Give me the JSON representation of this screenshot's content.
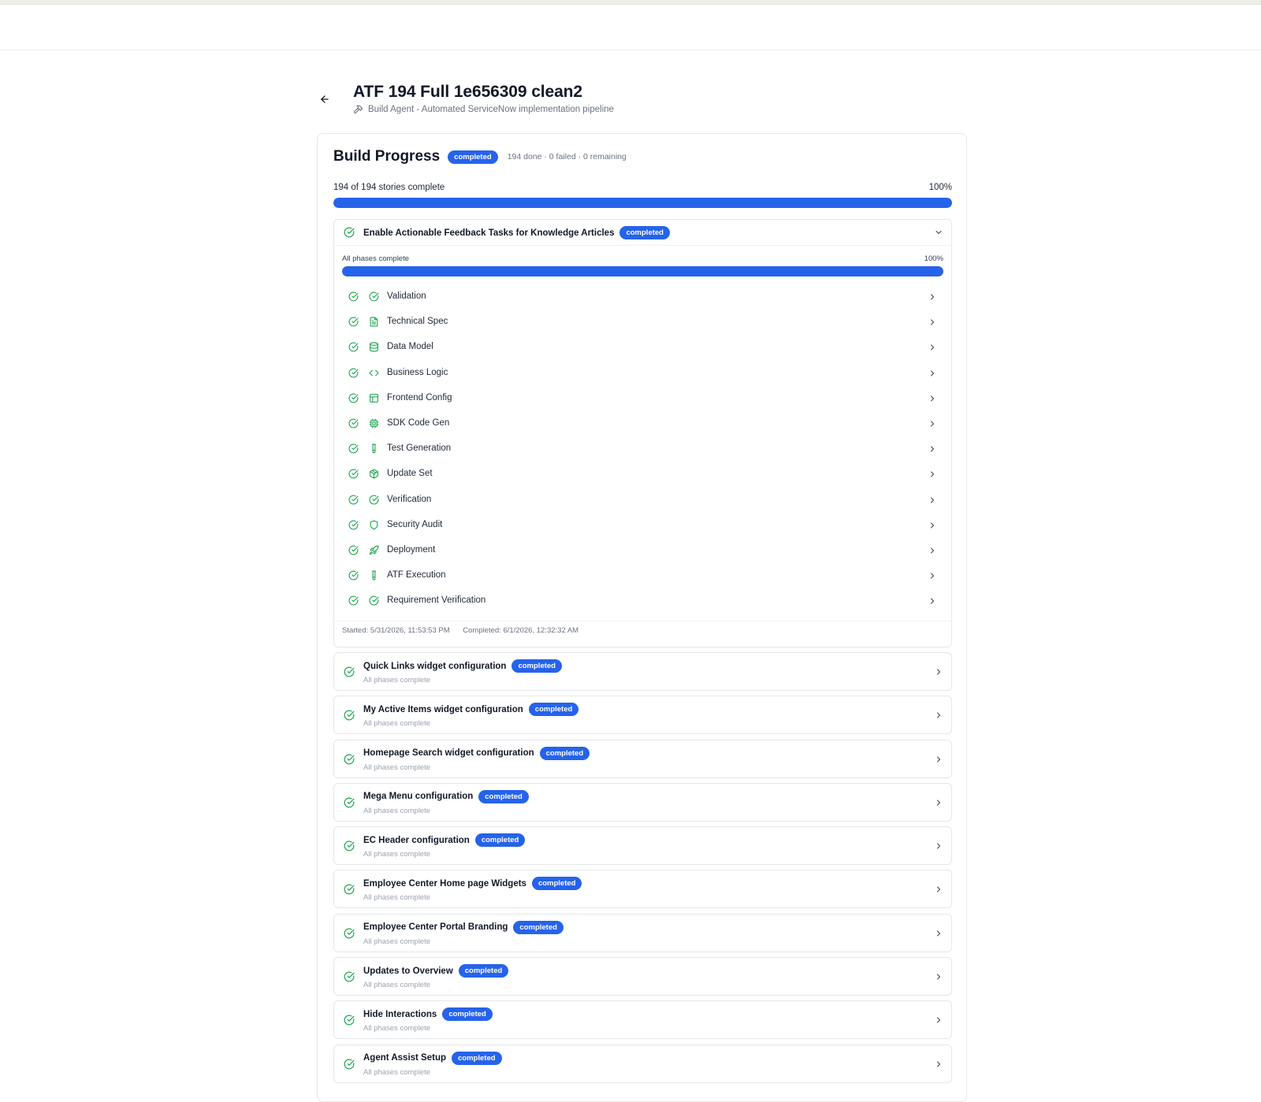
{
  "header": {
    "title": "ATF 194 Full 1e656309 clean2",
    "subtitle": "Build Agent - Automated ServiceNow implementation pipeline",
    "back_icon": "arrow-left-icon",
    "subtitle_icon": "hammer-icon"
  },
  "build_progress": {
    "title": "Build Progress",
    "status": "completed",
    "stats": "194 done · 0 failed · 0 remaining",
    "summary": "194 of 194 stories complete",
    "percent_label": "100%",
    "progress_fraction": 1.0
  },
  "expanded_story": {
    "title": "Enable Actionable Feedback Tasks for Knowledge Articles",
    "status": "completed",
    "phase_summary": "All phases complete",
    "phase_percent_label": "100%",
    "phase_progress_fraction": 1.0,
    "phases": [
      {
        "label": "Validation",
        "icon": "check-circle-icon"
      },
      {
        "label": "Technical Spec",
        "icon": "file-text-icon"
      },
      {
        "label": "Data Model",
        "icon": "database-icon"
      },
      {
        "label": "Business Logic",
        "icon": "code-icon"
      },
      {
        "label": "Frontend Config",
        "icon": "layout-icon"
      },
      {
        "label": "SDK Code Gen",
        "icon": "cpu-icon"
      },
      {
        "label": "Test Generation",
        "icon": "test-tube-icon"
      },
      {
        "label": "Update Set",
        "icon": "package-icon"
      },
      {
        "label": "Verification",
        "icon": "check-circle-icon"
      },
      {
        "label": "Security Audit",
        "icon": "shield-icon"
      },
      {
        "label": "Deployment",
        "icon": "rocket-icon"
      },
      {
        "label": "ATF Execution",
        "icon": "test-tube-icon"
      },
      {
        "label": "Requirement Verification",
        "icon": "check-circle-icon"
      }
    ],
    "started": "Started: 5/31/2026, 11:53:53 PM",
    "completed": "Completed: 6/1/2026, 12:32:32 AM"
  },
  "stories": [
    {
      "title": "Quick Links widget configuration",
      "status": "completed",
      "subtitle": "All phases complete"
    },
    {
      "title": "My Active Items widget configuration",
      "status": "completed",
      "subtitle": "All phases complete"
    },
    {
      "title": "Homepage Search widget configuration",
      "status": "completed",
      "subtitle": "All phases complete"
    },
    {
      "title": "Mega Menu configuration",
      "status": "completed",
      "subtitle": "All phases complete"
    },
    {
      "title": "EC Header configuration",
      "status": "completed",
      "subtitle": "All phases complete"
    },
    {
      "title": "Employee Center Home page Widgets",
      "status": "completed",
      "subtitle": "All phases complete"
    },
    {
      "title": "Employee Center Portal Branding",
      "status": "completed",
      "subtitle": "All phases complete"
    },
    {
      "title": "Updates to Overview",
      "status": "completed",
      "subtitle": "All phases complete"
    },
    {
      "title": "Hide Interactions",
      "status": "completed",
      "subtitle": "All phases complete"
    },
    {
      "title": "Agent Assist Setup",
      "status": "completed",
      "subtitle": "All phases complete"
    }
  ],
  "colors": {
    "accent": "#2563eb",
    "success": "#16a34a",
    "muted_text": "#6b7280",
    "border": "#e5e7eb"
  }
}
